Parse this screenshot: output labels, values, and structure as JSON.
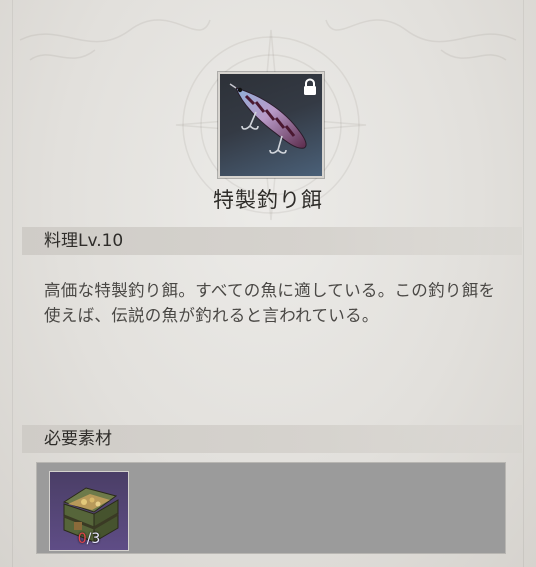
{
  "item": {
    "name": "特製釣り餌",
    "icon": "fishing-lure-icon",
    "locked": true
  },
  "cooking_level_label": "料理Lv.10",
  "description": "高価な特製釣り餌。すべての魚に適している。この釣り餌を使えば、伝説の魚が釣れると言われている。",
  "materials_header": "必要素材",
  "materials": [
    {
      "icon": "treasure-chest-icon",
      "have": "0",
      "need": "3"
    }
  ],
  "colors": {
    "required_missing": "#e5454a",
    "slot_background": "#5f4d86",
    "panel_background": "#9b9b9b"
  }
}
